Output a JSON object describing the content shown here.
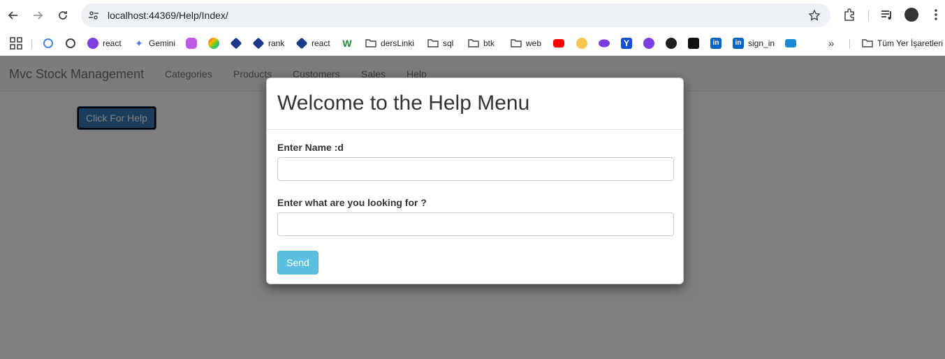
{
  "browser": {
    "url": "localhost:44369/Help/Index/",
    "bookmarks": [
      "react",
      "Gemini",
      "rank",
      "react",
      "dersLinki",
      "sql",
      "btk",
      "web",
      "sign_in"
    ],
    "all_bookmarks_label": "Tüm Yer İşaretleri"
  },
  "app": {
    "brand": "Mvc Stock Management",
    "nav": [
      "Categories",
      "Products",
      "Customers",
      "Sales",
      "Help"
    ],
    "help_button": "Click For Help"
  },
  "modal": {
    "title": "Welcome to the Help Menu",
    "name_label": "Enter Name :d",
    "name_value": "",
    "query_label": "Enter what are you looking for ?",
    "query_value": "",
    "send_label": "Send"
  },
  "colors": {
    "primary": "#337ab7",
    "info": "#5bc0de",
    "backdrop": "rgba(0,0,0,0.5)"
  }
}
